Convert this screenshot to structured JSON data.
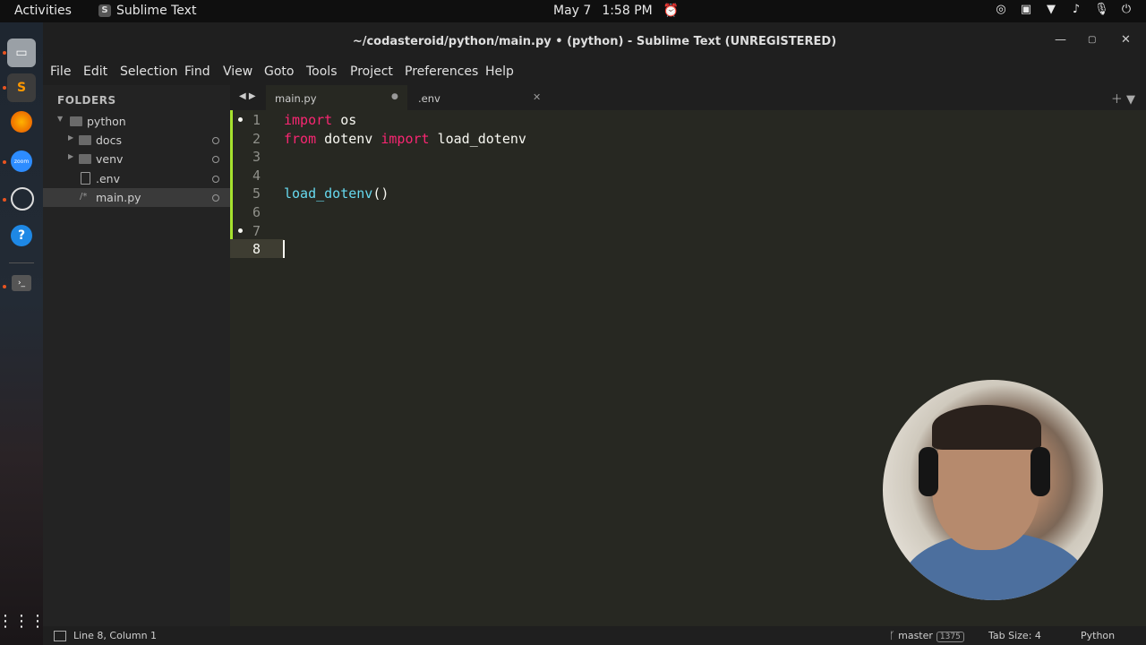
{
  "topbar": {
    "activities": "Activities",
    "app_name": "Sublime Text",
    "date": "May 7",
    "time": "1:58 PM"
  },
  "window": {
    "title": "~/codasteroid/python/main.py • (python) - Sublime Text (UNREGISTERED)"
  },
  "menu": [
    "File",
    "Edit",
    "Selection",
    "Find",
    "View",
    "Goto",
    "Tools",
    "Project",
    "Preferences",
    "Help"
  ],
  "sidebar": {
    "header": "FOLDERS",
    "items": [
      {
        "label": "python",
        "type": "folder-open"
      },
      {
        "label": "docs",
        "type": "folder"
      },
      {
        "label": "venv",
        "type": "folder"
      },
      {
        "label": ".env",
        "type": "file"
      },
      {
        "label": "main.py",
        "type": "file",
        "selected": true
      }
    ]
  },
  "tabs": [
    {
      "label": "main.py",
      "active": true,
      "modified": true
    },
    {
      "label": ".env",
      "active": false
    }
  ],
  "editor": {
    "line_numbers": [
      "1",
      "2",
      "3",
      "4",
      "5",
      "6",
      "7",
      "8"
    ],
    "current_line": 8,
    "lines": [
      {
        "tokens": [
          {
            "t": "import",
            "c": "kw"
          },
          {
            "t": " os",
            "c": ""
          }
        ]
      },
      {
        "tokens": [
          {
            "t": "from",
            "c": "kw"
          },
          {
            "t": " dotenv ",
            "c": ""
          },
          {
            "t": "import",
            "c": "kw"
          },
          {
            "t": " load_dotenv",
            "c": ""
          }
        ]
      },
      {
        "tokens": []
      },
      {
        "tokens": []
      },
      {
        "tokens": [
          {
            "t": "load_dotenv",
            "c": "fn"
          },
          {
            "t": "()",
            "c": ""
          }
        ]
      },
      {
        "tokens": []
      },
      {
        "tokens": []
      },
      {
        "tokens": []
      }
    ]
  },
  "status": {
    "position": "Line 8, Column 1",
    "branch": "master",
    "branch_count": "1375",
    "tab_size": "Tab Size: 4",
    "syntax": "Python"
  },
  "colors": {
    "keyword": "#f92672",
    "function": "#66d9ef",
    "modified_bar": "#a6e22e"
  }
}
